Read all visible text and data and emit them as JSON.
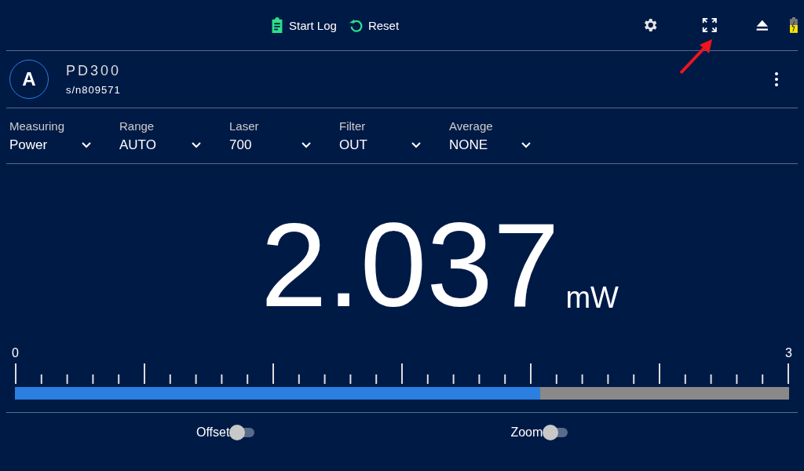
{
  "toolbar": {
    "start_log": "Start Log",
    "reset": "Reset"
  },
  "device": {
    "badge": "A",
    "model": "PD300",
    "serial": "s/n809571"
  },
  "settings": [
    {
      "label": "Measuring",
      "value": "Power"
    },
    {
      "label": "Range",
      "value": "AUTO"
    },
    {
      "label": "Laser",
      "value": "700"
    },
    {
      "label": "Filter",
      "value": "OUT"
    },
    {
      "label": "Average",
      "value": "NONE"
    }
  ],
  "reading": {
    "value": "2.037",
    "unit": "mW"
  },
  "scale": {
    "min": "0",
    "max": "3",
    "level": 0.679
  },
  "toggles": [
    {
      "label": "Offset",
      "on": false
    },
    {
      "label": "Zoom",
      "on": false
    }
  ]
}
